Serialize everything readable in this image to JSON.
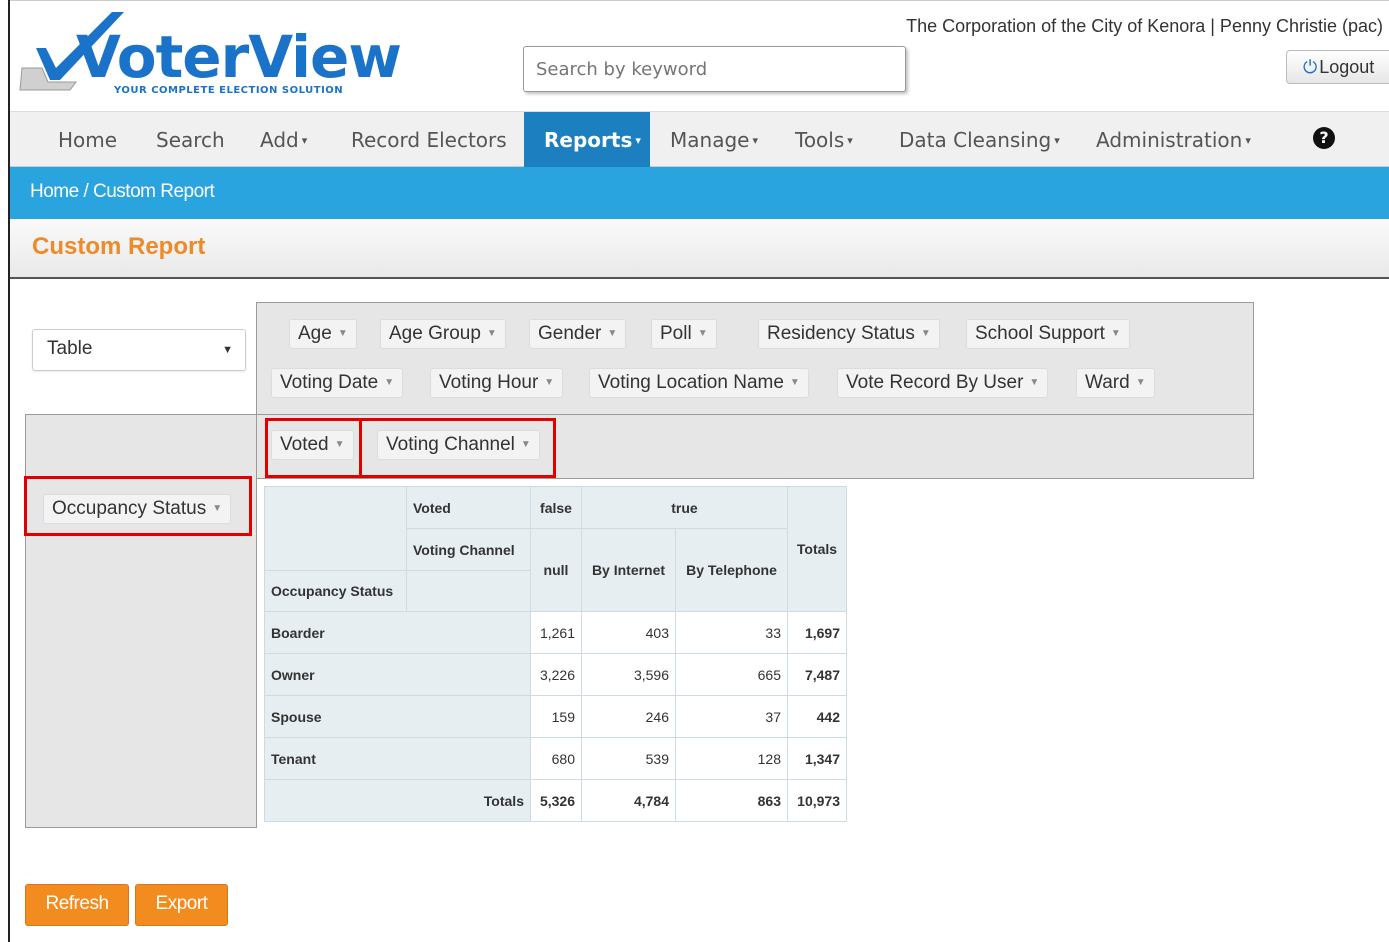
{
  "brand": {
    "name": "VoterView",
    "tagline": "YOUR COMPLETE ELECTION SOLUTION"
  },
  "header": {
    "org_line": "The Corporation of the City of Kenora | Penny Christie (pac)",
    "search_placeholder": "Search by keyword",
    "logout_label": "Logout"
  },
  "nav": {
    "items": [
      {
        "label": "Home"
      },
      {
        "label": "Search"
      },
      {
        "label": "Add"
      },
      {
        "label": "Record Electors"
      },
      {
        "label": "Reports"
      },
      {
        "label": "Manage"
      },
      {
        "label": "Tools"
      },
      {
        "label": "Data Cleansing"
      },
      {
        "label": "Administration"
      }
    ],
    "active": "Reports",
    "help_icon": "question-circle-icon"
  },
  "breadcrumb": "Home / Custom Report",
  "page_title": "Custom Report",
  "pivot": {
    "renderer": "Table",
    "unused_fields": [
      "Age",
      "Age Group",
      "Gender",
      "Poll",
      "Residency Status",
      "School Support",
      "Voting Date",
      "Voting Hour",
      "Voting Location Name",
      "Vote Record By User",
      "Ward"
    ],
    "col_fields": [
      "Voted",
      "Voting Channel"
    ],
    "row_fields": [
      "Occupancy Status"
    ],
    "table": {
      "col_attr_1": "Voted",
      "col_attr_2": "Voting Channel",
      "row_attr": "Occupancy Status",
      "voted_false": "false",
      "voted_true": "true",
      "channels": [
        "null",
        "By Internet",
        "By Telephone"
      ],
      "totals_label": "Totals",
      "rows": [
        {
          "label": "Boarder",
          "values": [
            "1,261",
            "403",
            "33"
          ],
          "total": "1,697"
        },
        {
          "label": "Owner",
          "values": [
            "3,226",
            "3,596",
            "665"
          ],
          "total": "7,487"
        },
        {
          "label": "Spouse",
          "values": [
            "159",
            "246",
            "37"
          ],
          "total": "442"
        },
        {
          "label": "Tenant",
          "values": [
            "680",
            "539",
            "128"
          ],
          "total": "1,347"
        }
      ],
      "col_totals": [
        "5,326",
        "4,784",
        "863"
      ],
      "grand_total": "10,973"
    }
  },
  "actions": {
    "refresh": "Refresh",
    "export": "Export"
  },
  "colors": {
    "brand_blue": "#1a73c9",
    "nav_active": "#1b7fc0",
    "breadcrumb_bar": "#2aa4de",
    "title_orange": "#ee8a2a",
    "button_orange": "#f28c1f",
    "highlight_red": "#e00000"
  }
}
